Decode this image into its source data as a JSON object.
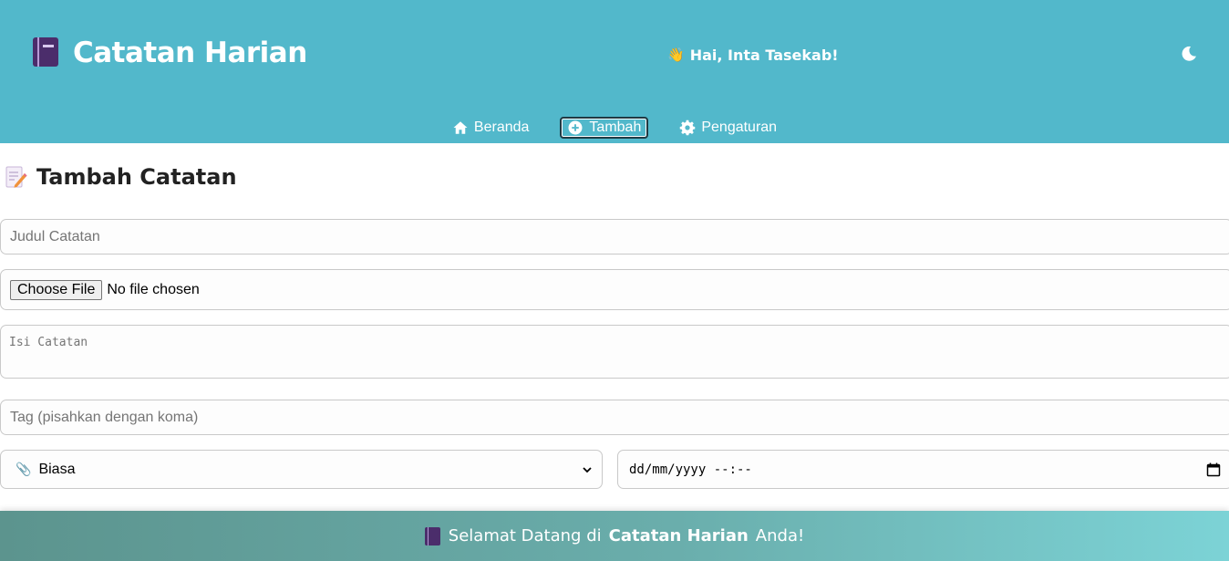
{
  "header": {
    "app_title": "Catatan Harian",
    "app_icon": "notebook-icon",
    "greeting": "Hai, Inta Tasekab!",
    "greeting_icon": "waving-hand-icon",
    "theme_toggle_icon": "moon-icon"
  },
  "nav": {
    "items": [
      {
        "label": "Beranda",
        "icon": "home-icon"
      },
      {
        "label": "Tambah",
        "icon": "plus-circle-icon",
        "active": true
      },
      {
        "label": "Pengaturan",
        "icon": "gear-icon"
      }
    ]
  },
  "main": {
    "page_title": "Tambah Catatan",
    "page_title_icon": "memo-icon",
    "title_placeholder": "Judul Catatan",
    "file_button_label": "Choose File",
    "file_status": "No file chosen",
    "content_placeholder": "Isi Catatan",
    "tags_placeholder": "Tag (pisahkan dengan koma)",
    "priority_selected": "Biasa",
    "priority_icon": "paperclip-icon",
    "datetime_placeholder": "dd/mm/yyyy --:--"
  },
  "footer": {
    "prefix": "Selamat Datang di",
    "app_name": "Catatan Harian",
    "suffix": "Anda!"
  },
  "colors": {
    "header_bg": "#52b8cb",
    "footer_gradient_start": "#5c948e",
    "footer_gradient_end": "#7cd3d6",
    "text_dark": "#222222"
  }
}
